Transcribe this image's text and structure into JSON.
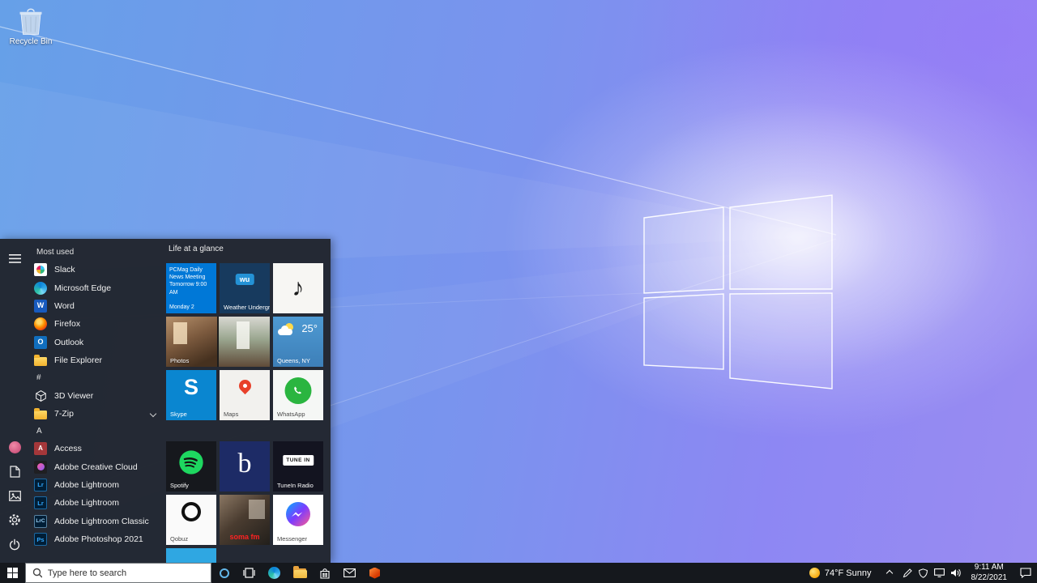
{
  "desktop": {
    "recycle_bin_label": "Recycle Bin"
  },
  "start_menu": {
    "most_used_header": "Most used",
    "most_used": [
      {
        "label": "Slack"
      },
      {
        "label": "Microsoft Edge"
      },
      {
        "label": "Word",
        "badge": "W"
      },
      {
        "label": "Firefox"
      },
      {
        "label": "Outlook",
        "badge": "O"
      },
      {
        "label": "File Explorer"
      }
    ],
    "section_hash": {
      "header": "#",
      "apps": [
        {
          "label": "3D Viewer"
        },
        {
          "label": "7-Zip"
        }
      ]
    },
    "section_a": {
      "header": "A",
      "apps": [
        {
          "label": "Access",
          "badge": "A"
        },
        {
          "label": "Adobe Creative Cloud"
        },
        {
          "label": "Adobe Lightroom",
          "badge": "Lr"
        },
        {
          "label": "Adobe Lightroom",
          "badge": "Lr"
        },
        {
          "label": "Adobe Lightroom Classic",
          "badge": "LrC"
        },
        {
          "label": "Adobe Photoshop 2021",
          "badge": "Ps"
        }
      ]
    },
    "tiles_group1": {
      "header": "Life at a glance",
      "calendar": {
        "event": "PCMag Daily News Meeting",
        "time": "Tomorrow 9:00 AM",
        "footer": "Monday 2"
      },
      "weather_underground": {
        "logo": "wu",
        "label": "Weather Underground"
      },
      "music_note": "♪",
      "photos": {
        "label": "Photos"
      },
      "weather": {
        "temp": "25°",
        "location": "Queens, NY"
      },
      "skype": {
        "letter": "S",
        "label": "Skype"
      },
      "maps": {
        "label": "Maps"
      },
      "whatsapp": {
        "label": "WhatsApp"
      }
    },
    "tiles_group2": {
      "spotify": {
        "label": "Spotify"
      },
      "b_tile": {
        "letter": "b"
      },
      "tunein": {
        "logo": "TUNE IN",
        "label": "TuneIn Radio"
      },
      "qobuz": {
        "label": "Qobuz"
      },
      "somafm": {
        "text": "soma fm"
      },
      "messenger": {
        "label": "Messenger"
      }
    }
  },
  "taskbar": {
    "search_placeholder": "Type here to search",
    "tray": {
      "weather": "74°F Sunny",
      "time": "9:11 AM",
      "date": "8/22/2021"
    }
  },
  "icons": {
    "hamburger": "menu-bars",
    "user": "avatar-circle",
    "documents": "document",
    "pictures": "image",
    "settings": "gear",
    "power": "power-symbol",
    "search": "magnifier",
    "cortana": "ring",
    "task_view": "stacked-rectangles",
    "hidden_icons": "chevron-up",
    "action_center": "speech-bubble"
  },
  "colors": {
    "accent_blue": "#0078d7",
    "taskbar_bg": "#15181d",
    "start_menu_bg": "#21252d",
    "spotify_green": "#1ed760",
    "whatsapp_green": "#2ab540"
  }
}
